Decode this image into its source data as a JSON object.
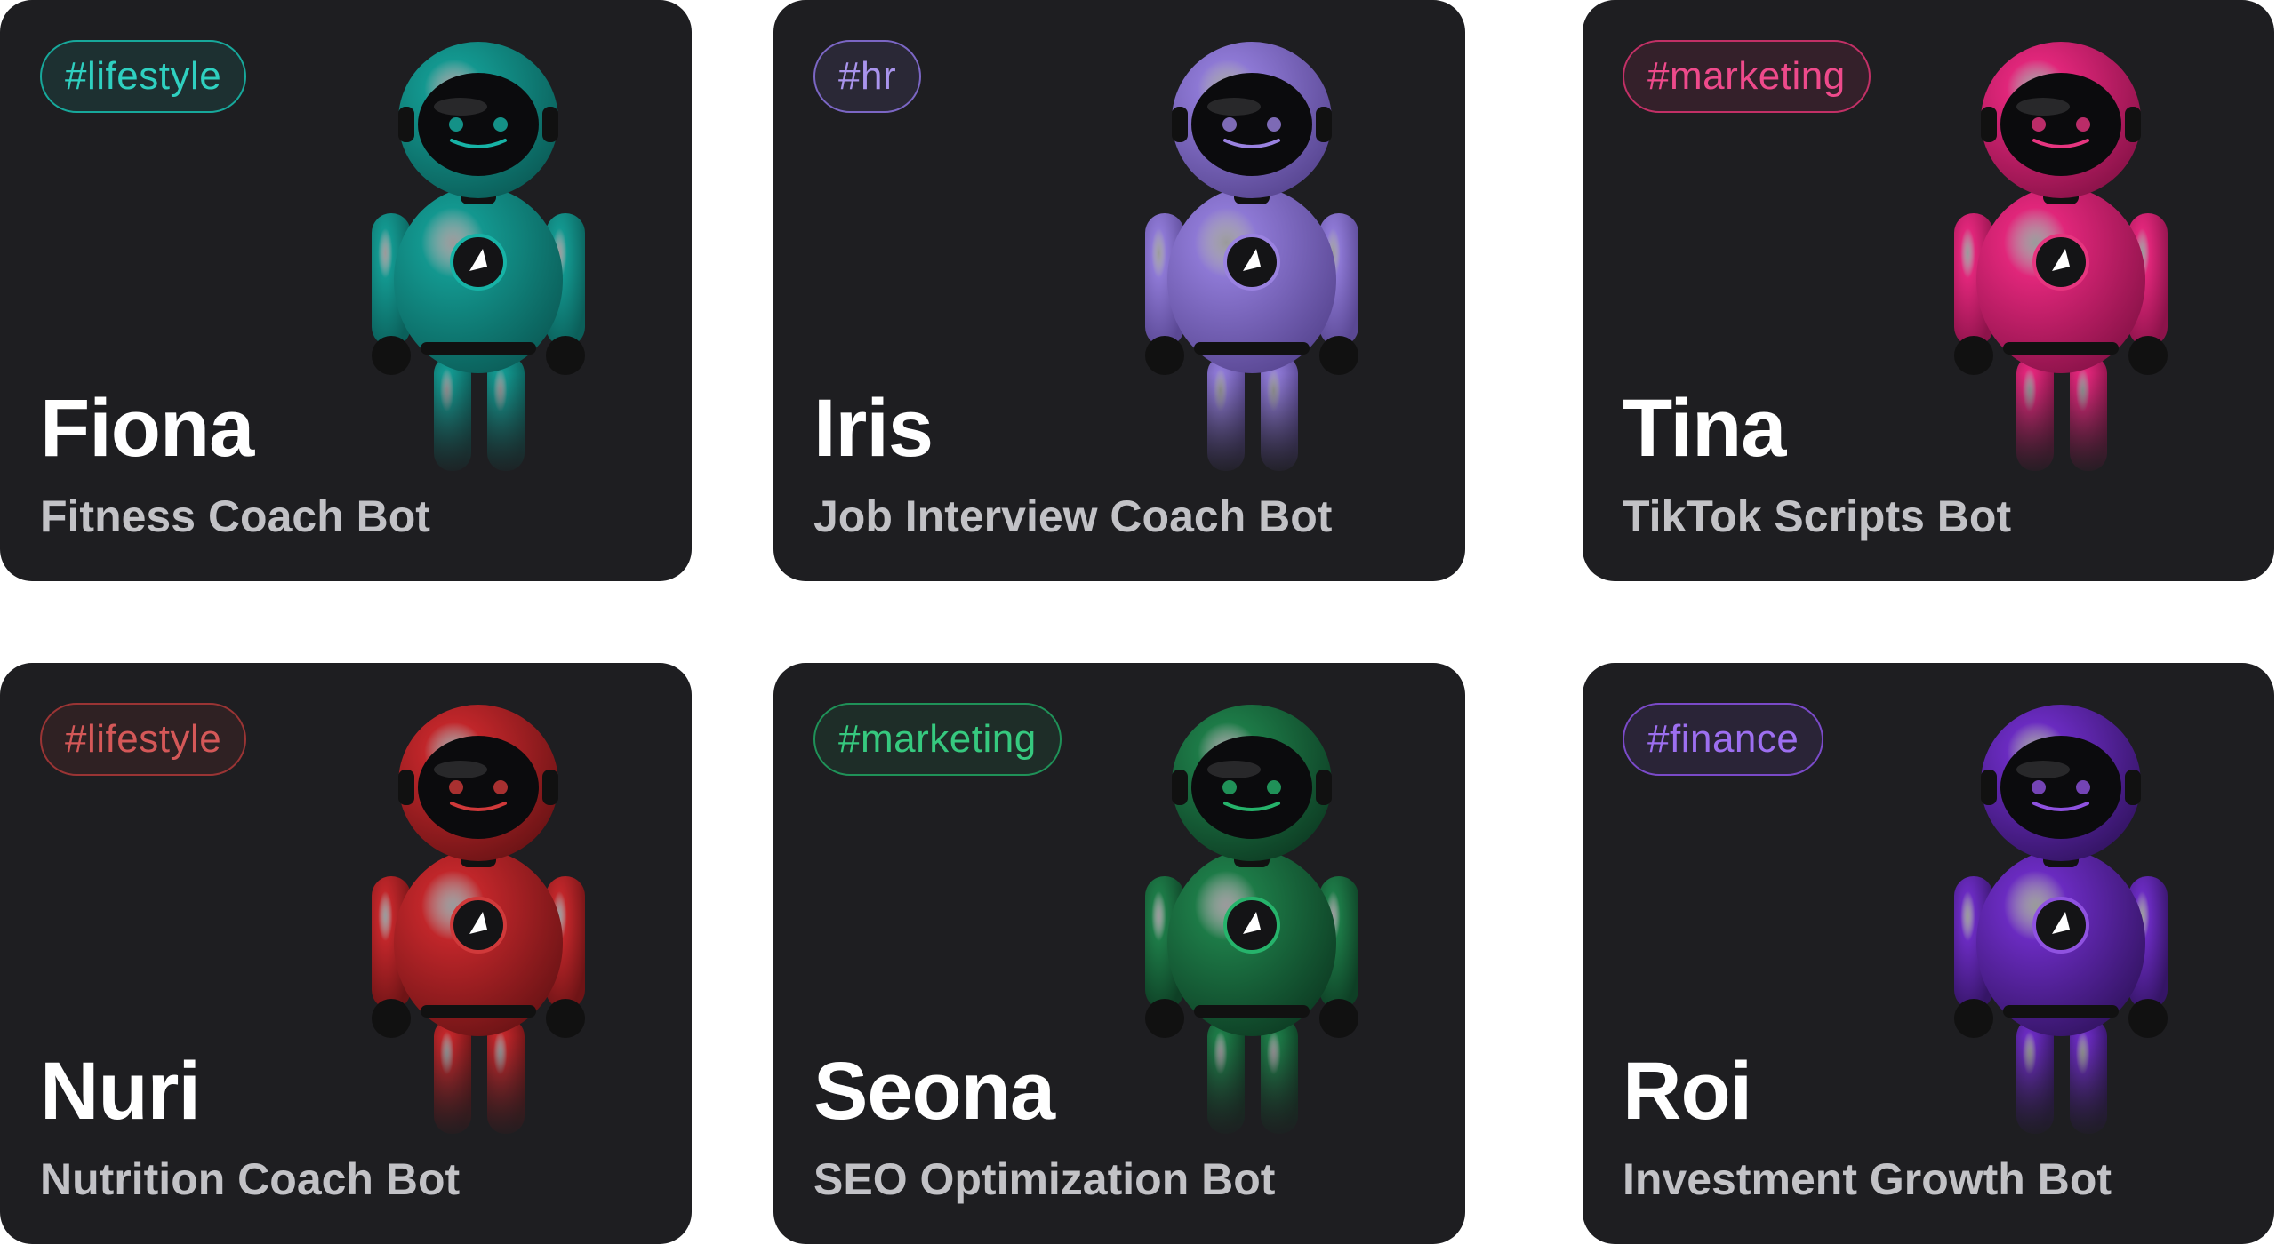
{
  "cards": [
    {
      "tag": "#lifestyle",
      "name": "Fiona",
      "subtitle": "Fitness Coach Bot",
      "accent": "#17b3a6",
      "tag_text": "#2fd0c0",
      "tag_border": "#17a89b",
      "body": "#13978f",
      "body_dark": "#0b5f5a",
      "icon": "robot-fitness-icon"
    },
    {
      "tag": "#hr",
      "name": "Iris",
      "subtitle": "Job Interview Coach Bot",
      "accent": "#9a82e0",
      "tag_text": "#a994ec",
      "tag_border": "#7b66c4",
      "body": "#8d78d4",
      "body_dark": "#5a4894",
      "icon": "robot-interview-icon"
    },
    {
      "tag": "#marketing",
      "name": "Tina",
      "subtitle": "TikTok Scripts Bot",
      "accent": "#e6357f",
      "tag_text": "#ee4a8b",
      "tag_border": "#c23066",
      "body": "#e0267a",
      "body_dark": "#8c134a",
      "icon": "robot-tiktok-icon"
    },
    {
      "tag": "#lifestyle",
      "name": "Nuri",
      "subtitle": "Nutrition Coach Bot",
      "accent": "#d0393a",
      "tag_text": "#d45858",
      "tag_border": "#9a3434",
      "body": "#c0262a",
      "body_dark": "#6e1416",
      "icon": "robot-nutrition-icon"
    },
    {
      "tag": "#marketing",
      "name": "Seona",
      "subtitle": "SEO Optimization Bot",
      "accent": "#26b36b",
      "tag_text": "#36c97f",
      "tag_border": "#1f9158",
      "body": "#1d7a47",
      "body_dark": "#0e3f25",
      "icon": "robot-seo-icon"
    },
    {
      "tag": "#finance",
      "name": "Roi",
      "subtitle": "Investment Growth Bot",
      "accent": "#8f52e0",
      "tag_text": "#9d6ff0",
      "tag_border": "#7a4ac8",
      "body": "#6a2bc0",
      "body_dark": "#351566",
      "icon": "robot-finance-icon"
    }
  ]
}
